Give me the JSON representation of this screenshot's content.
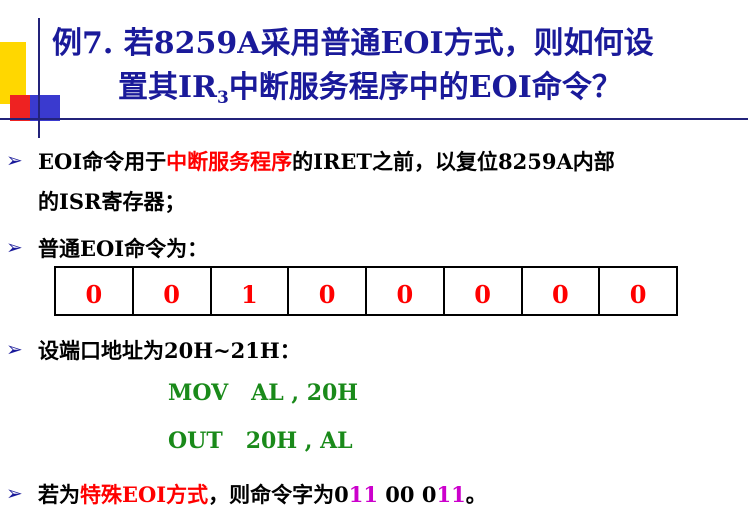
{
  "title": {
    "line1": "例7. 若8259A采用普通EOI方式，则如何设",
    "line2_pre": "置其IR",
    "line2_sub": "3",
    "line2_post": "中断服务程序中的EOI命令？"
  },
  "bullets": {
    "b1_pre": "EOI命令用于",
    "b1_red": "中断服务程序",
    "b1_post": "的IRET之前，以复位8259A内部",
    "b1_line2": "的ISR寄存器；",
    "b2": "普通EOI命令为：",
    "b3": "设端口地址为20H~21H：",
    "b4_pre": "若为",
    "b4_red": "特殊EOI方式",
    "b4_mid": "，则命令字为0",
    "b4_purple1": "11",
    "b4_space": " 00 0",
    "b4_purple2": "11",
    "b4_end": "。"
  },
  "bits": [
    "0",
    "0",
    "1",
    "0",
    "0",
    "0",
    "0",
    "0"
  ],
  "code": {
    "line1": "MOV   AL , 20H",
    "line2": "OUT   20H , AL"
  },
  "colors": {
    "title": "#1a1a9a",
    "highlight_red": "#ff0000",
    "highlight_purple": "#cc00cc",
    "code_green": "#1a8a1a"
  },
  "icons": {
    "bullet": "arrow-bullet-icon"
  }
}
